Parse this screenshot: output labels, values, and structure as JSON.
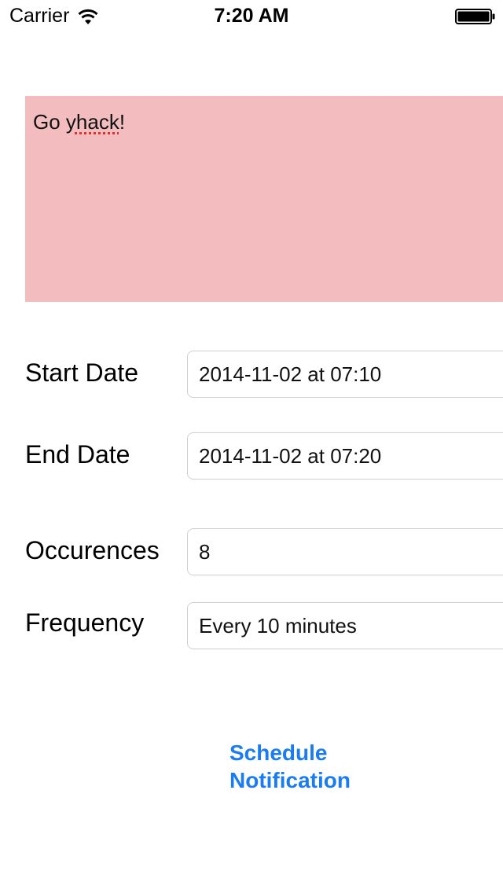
{
  "status_bar": {
    "carrier": "Carrier",
    "time": "7:20 AM",
    "wifi_icon": "wifi-icon",
    "battery_icon": "battery-icon"
  },
  "message": {
    "prefix": "Go ",
    "misspelled_word": "yhack",
    "suffix": "!",
    "background_color": "#f3bdbf",
    "spellcheck_color": "#e0312f"
  },
  "form": {
    "start_date": {
      "label": "Start Date",
      "value": "2014-11-02 at 07:10"
    },
    "end_date": {
      "label": "End Date",
      "value": "2014-11-02 at 07:20"
    },
    "occurrences": {
      "label": "Occurences",
      "value": "8"
    },
    "frequency": {
      "label": "Frequency",
      "value": "Every 10 minutes"
    }
  },
  "schedule_button": {
    "line1": "Schedule",
    "line2": "Notification",
    "color": "#1a7cf0"
  }
}
